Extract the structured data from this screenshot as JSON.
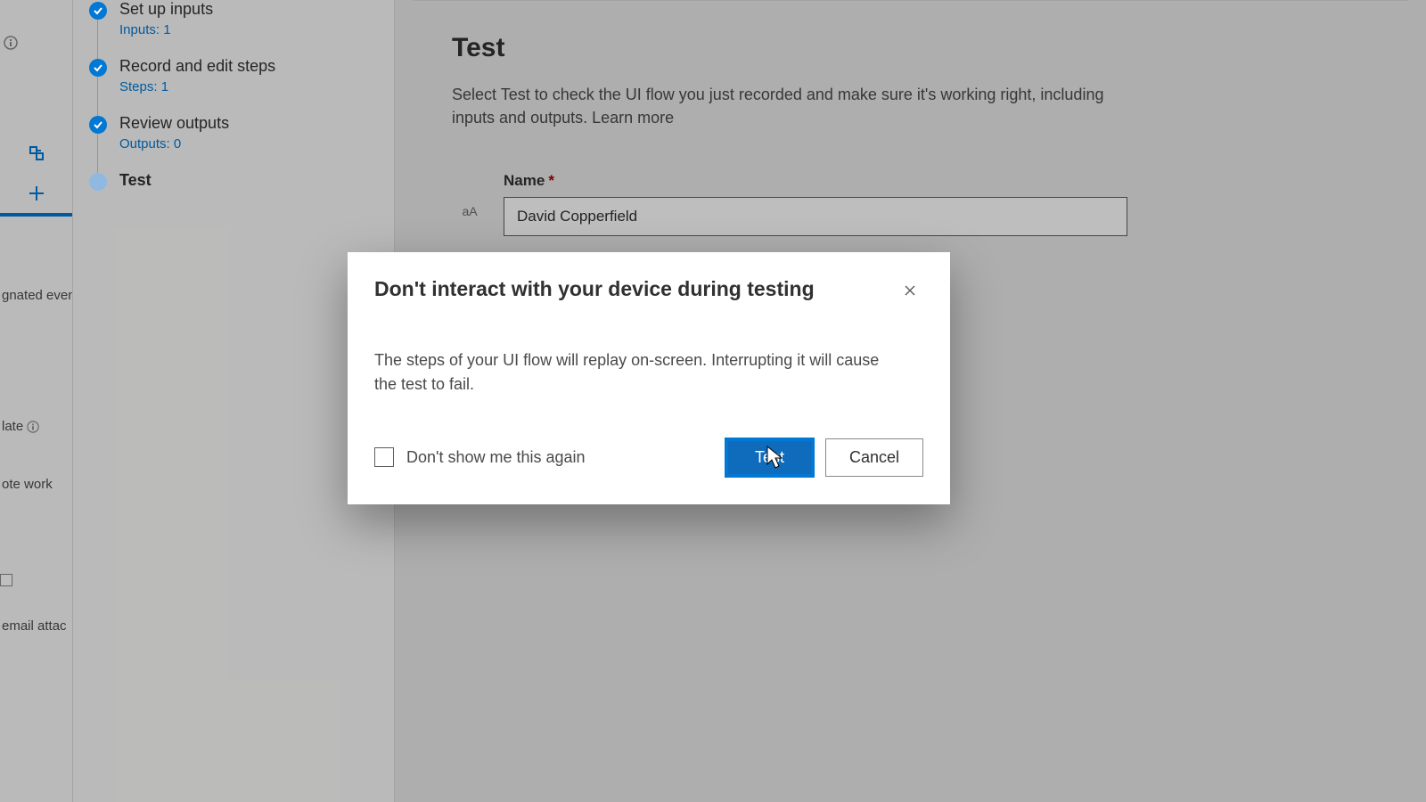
{
  "farLeft": {
    "fragment_signed_events": "gnated even",
    "fragment_plate": "late",
    "fragment_ote_work": "ote work",
    "fragment_email_attach": "email attac"
  },
  "steps": [
    {
      "title": "Set up inputs",
      "sub": "Inputs: 1",
      "done": true
    },
    {
      "title": "Record and edit steps",
      "sub": "Steps: 1",
      "done": true
    },
    {
      "title": "Review outputs",
      "sub": "Outputs: 0",
      "done": true
    },
    {
      "title": "Test",
      "sub": "",
      "done": false
    }
  ],
  "main": {
    "heading": "Test",
    "description": "Select Test to check the UI flow you just recorded and make sure it's working right, including inputs and outputs. Learn more",
    "name_label": "Name",
    "required_mark": "*",
    "name_value": "David Copperfield",
    "type_badge": "aA"
  },
  "dialog": {
    "title": "Don't interact with your device during testing",
    "body": "The steps of your UI flow will replay on-screen. Interrupting it will cause the test to fail.",
    "dont_show": "Don't show me this again",
    "test_label": "Test",
    "cancel_label": "Cancel"
  }
}
